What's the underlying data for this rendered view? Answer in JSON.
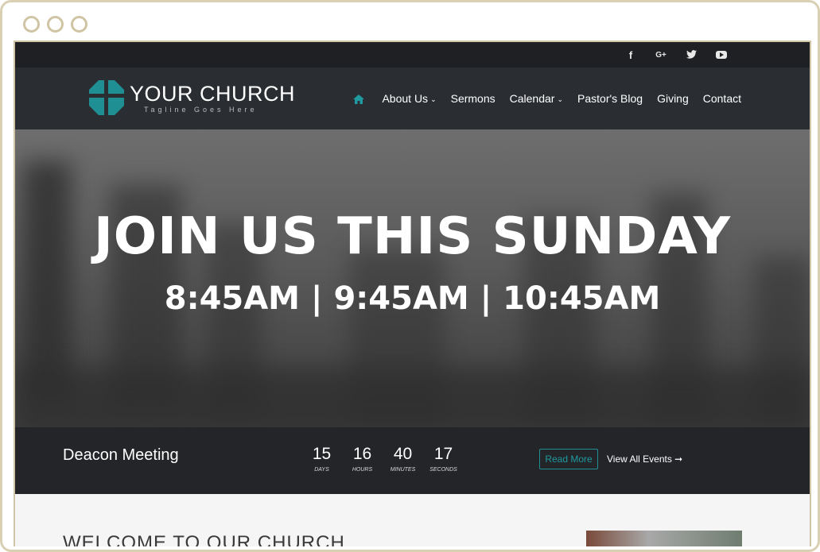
{
  "social": [
    "f",
    "G+",
    "t",
    "youtube"
  ],
  "logo": {
    "title": "YOUR CHURCH",
    "tagline": "Tagline Goes Here"
  },
  "nav": {
    "items": [
      {
        "label": "About Us",
        "caret": "⌄"
      },
      {
        "label": "Sermons"
      },
      {
        "label": "Calendar",
        "caret": "⌄"
      },
      {
        "label": "Pastor's Blog"
      },
      {
        "label": "Giving"
      },
      {
        "label": "Contact"
      }
    ]
  },
  "hero": {
    "title": "JOIN US THIS SUNDAY",
    "times": "8:45AM | 9:45AM | 10:45AM"
  },
  "event": {
    "name": "Deacon Meeting",
    "countdown": [
      {
        "value": "15",
        "label": "DAYS"
      },
      {
        "value": "16",
        "label": "HOURS"
      },
      {
        "value": "40",
        "label": "MINUTES"
      },
      {
        "value": "17",
        "label": "SECONDS"
      }
    ],
    "read_more": "Read More",
    "view_all": "View All Events ➞"
  },
  "content": {
    "welcome": "WELCOME TO OUR CHURCH"
  },
  "colors": {
    "accent": "#1f9aa0",
    "header": "#2a2e33",
    "topbar": "#1e2023"
  }
}
